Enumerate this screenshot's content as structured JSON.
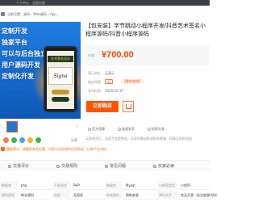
{
  "topbar": {
    "item_1": "个人中心",
    "item_2": "全部分类"
  },
  "breadcrumb": {
    "text": "当前位置：源码 › Web源码 › App..."
  },
  "hero": {
    "lines": [
      "定制开发",
      "独家平台",
      "可以与后台独立",
      "用户源码开发",
      "定制化开发"
    ],
    "screen_title": "艺术签名设计",
    "signature": "Signa"
  },
  "social": {
    "share_label": "分享"
  },
  "notice": {
    "text": "重要提示：请确定商品标题、内容与实际相符后再购买，以免产生纠纷"
  },
  "product": {
    "title": "【包安装】字节跳动小程序开发/抖音艺术签名小程序源码/抖音小程序源码",
    "price_label": "价格",
    "price": "¥700.00",
    "info": [
      {
        "key": "演示地址",
        "value": "无演示"
      },
      {
        "key": "服务保障",
        "tag": "无",
        "tag2": "【需求咨询】"
      },
      {
        "key": "发布时间",
        "value": "2020-10-17"
      }
    ],
    "buy_label": "立即购买",
    "guarantees": [
      "官方保障",
      "极速发货",
      "担保交易"
    ],
    "slogan": "买家收货后，卖家才会收到钱，买家如需退款请联系客服，保障买家的权益"
  },
  "tabs": [
    "交易评价",
    "交易规则",
    "常见问题",
    "买家必读"
  ],
  "spec": {
    "rows": [
      [
        {
          "key": "数据库",
          "value": "php"
        },
        {
          "key": "开发语言",
          "value": "PHP"
        },
        {
          "key": "数据库",
          "value": "Mysql"
        },
        {
          "key": "小程序类型",
          "value": "小程序"
        }
      ],
      [
        {
          "key": "源码类型",
          "value": "商业源码"
        },
        {
          "key": "授权",
          "value": "无授权"
        },
        {
          "key": "安装服务",
          "value": "帮助安装"
        },
        {
          "key": "源码文件",
          "value": "完全开源（含全部源代码）"
        }
      ]
    ]
  },
  "colors": {
    "accent": "#ff5500",
    "price": "#ff4400",
    "hero_blue": "#1a6fd6"
  }
}
